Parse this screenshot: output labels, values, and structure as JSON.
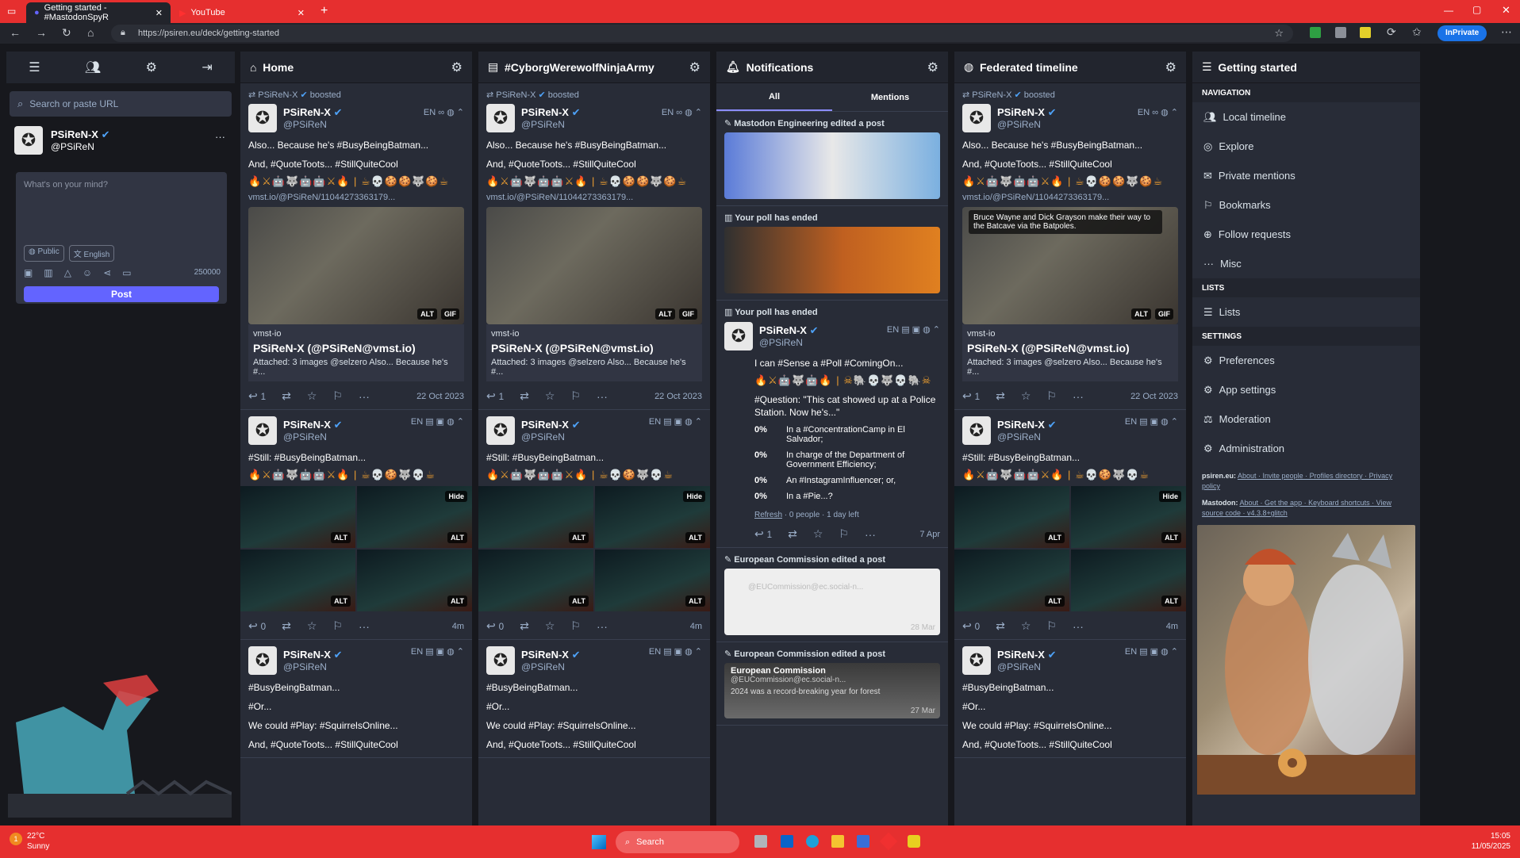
{
  "browser": {
    "tabs": [
      {
        "title": "Getting started - #MastodonSpyR",
        "active": true
      },
      {
        "title": "YouTube",
        "active": false
      }
    ],
    "url": "https://psiren.eu/deck/getting-started",
    "inprivate_label": "InPrivate"
  },
  "compose": {
    "search_placeholder": "Search or paste URL",
    "account_name": "PSiReN-X",
    "account_handle": "@PSiReN",
    "textarea_placeholder": "What's on your mind?",
    "visibility": "Public",
    "language": "English",
    "char_count": "250000",
    "post_button": "Post"
  },
  "columns": {
    "home": {
      "title": "Home"
    },
    "hashtag": {
      "title": "#CyborgWerewolfNinjaArmy"
    },
    "notifications": {
      "title": "Notifications",
      "tab_all": "All",
      "tab_mentions": "Mentions"
    },
    "federated": {
      "title": "Federated timeline"
    },
    "getting_started": {
      "title": "Getting started"
    }
  },
  "post1": {
    "boost_line": "PSiReN-X",
    "boosted": "boosted",
    "name": "PSiReN-X",
    "handle": "@PSiReN",
    "lang": "EN",
    "text1": "Also... Because he's #BusyBeingBatman...",
    "text2": "And, #QuoteToots... #StillQuiteCool",
    "link": "vmst.io/@PSiReN/11044273363179...",
    "alt": "ALT",
    "gif": "GIF",
    "card_site": "vmst-io",
    "card_title": "PSiReN-X (@PSiReN@vmst.io)",
    "card_desc": "Attached: 3 images @selzero Also... Because he's #...",
    "replies": "1",
    "date": "22 Oct 2023",
    "fed_caption": "Bruce Wayne and Dick Grayson make their way to the Batcave via the Batpoles."
  },
  "post2": {
    "name": "PSiReN-X",
    "handle": "@PSiReN",
    "lang": "EN",
    "text": "#Still: #BusyBeingBatman...",
    "hide": "Hide",
    "alt": "ALT",
    "replies": "0",
    "time": "4m"
  },
  "post3": {
    "name": "PSiReN-X",
    "handle": "@PSiReN",
    "lang": "EN",
    "text1": "#BusyBeingBatman...",
    "text2": "#Or...",
    "text3": "We could #Play: #SquirrelsOnline...",
    "text4": "And, #QuoteToots... #StillQuiteCool"
  },
  "notifications": {
    "n1": "Mastodon Engineering edited a post",
    "n2": "Your poll has ended",
    "n3": "Your poll has ended",
    "poll_author": "PSiReN-X",
    "poll_handle": "@PSiReN",
    "poll_lang": "EN",
    "poll_text": "I can #Sense a #Poll #ComingOn...",
    "question": "#Question: \"This cat showed up at a Police Station. Now he's...\"",
    "options": [
      {
        "pct": "0%",
        "label": "In a #ConcentrationCamp in El Salvador;"
      },
      {
        "pct": "0%",
        "label": "In charge of the Department of Government Efficiency;"
      },
      {
        "pct": "0%",
        "label": "An #InstagramInfluencer; or,"
      },
      {
        "pct": "0%",
        "label": "In a #Pie...?"
      }
    ],
    "poll_footer_refresh": "Refresh",
    "poll_footer": " · 0 people · 1 day left",
    "poll_replies": "1",
    "poll_date": "7 Apr",
    "n4": "European Commission edited a post",
    "ec_handle": "@EUCommission@ec.social-n...",
    "n5": "European Commission edited a post",
    "ec_name": "European Commission",
    "ec_handle2": "@EUCommission@ec.social-n...",
    "ec_text": "2024 was a record-breaking year for forest",
    "ec_date1": "28 Mar",
    "ec_date2": "27 Mar"
  },
  "getting_started": {
    "nav_head": "Navigation",
    "items": [
      "Local timeline",
      "Explore",
      "Private mentions",
      "Bookmarks",
      "Follow requests",
      "Misc"
    ],
    "lists_head": "Lists",
    "lists_item": "Lists",
    "settings_head": "Settings",
    "settings_items": [
      "Preferences",
      "App settings",
      "Moderation",
      "Administration"
    ],
    "footer1_site": "psiren.eu:",
    "footer1_links": "About · Invite people · Profiles directory · Privacy policy",
    "footer2_site": "Mastodon:",
    "footer2_links": "About · Get the app · Keyboard shortcuts · View source code · v4.3.8+glitch"
  },
  "taskbar": {
    "temp": "22°C",
    "weather": "Sunny",
    "search": "Search",
    "time": "15:05",
    "date": "11/05/2025",
    "notif_count": "1"
  }
}
